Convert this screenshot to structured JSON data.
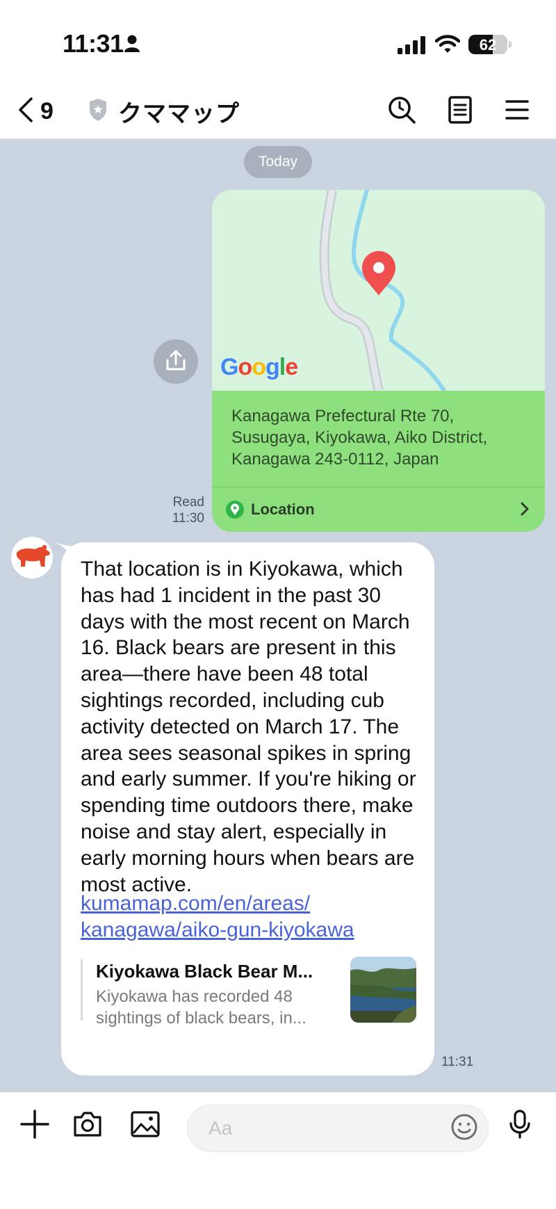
{
  "status_bar": {
    "time": "11:31",
    "battery": "62",
    "battery_level": 0.62
  },
  "header": {
    "back_count": "9",
    "title": "クママップ"
  },
  "chat": {
    "date_label": "Today",
    "location_message": {
      "address_lines": [
        "Kanagawa Prefectural Rte 70,",
        "Susugaya, Kiyokawa, Aiko District,",
        "Kanagawa 243-0112, Japan"
      ],
      "map_logo": "Google",
      "label": "Location",
      "read_label": "Read",
      "time": "11:30"
    },
    "reply_message": {
      "text": "That location is in Kiyokawa, which has had 1 incident in the past 30 days with the most recent on March 16. Black bears are present in this area—there have been 48 total sightings recorded, including cub activity detected on March 17. The area sees seasonal spikes in spring and early summer. If you're hiking or spending time outdoors there, make noise and stay alert, especially in early morning hours when bears are most active.",
      "link_lines": [
        "kumamap.com/en/areas/",
        "kanagawa/aiko-gun-kiyokawa"
      ],
      "preview_title": "Kiyokawa Black Bear M...",
      "preview_desc_lines": [
        "Kiyokawa has recorded 48",
        "sightings of black bears, in..."
      ],
      "time": "11:31"
    }
  },
  "input_bar": {
    "placeholder": "Aa"
  },
  "colors": {
    "chat_background": "#c9d4e0",
    "location_card": "#8ee07e",
    "map_background": "#d8f4de",
    "link": "#4a62d8",
    "pin": "#ef4f4f",
    "bear_icon": "#e4492a"
  },
  "icons": [
    "person-icon",
    "signal-icon",
    "wifi-icon",
    "back-chevron-icon",
    "shield-icon",
    "search-icon",
    "notes-icon",
    "menu-icon",
    "share-icon",
    "map-pin-icon",
    "location-pin-icon",
    "chevron-right-icon",
    "bear-icon",
    "plus-icon",
    "camera-icon",
    "image-icon",
    "emoji-icon",
    "microphone-icon"
  ]
}
